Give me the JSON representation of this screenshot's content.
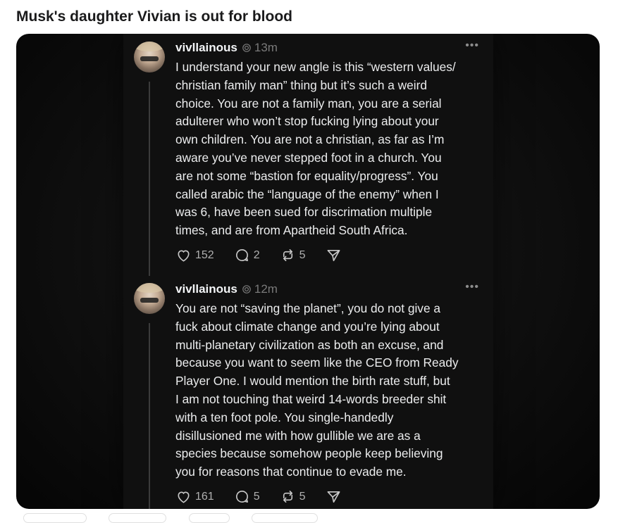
{
  "page": {
    "title": "Musk's daughter Vivian is out for blood"
  },
  "posts": [
    {
      "username": "vivllainous",
      "timestamp": "13m",
      "text": "I understand your new angle is this “western values/\nchristian family man” thing but it’s such a weird\nchoice. You are not a family man, you are a serial\nadulterer who won’t stop fucking lying about your\nown children. You are not a christian, as far as I’m\naware you’ve never stepped foot in a church. You\nare not some “bastion for equality/progress”. You\ncalled arabic the “language of the enemy” when I\nwas 6, have been sued for discrimation multiple\ntimes, and are from Apartheid South Africa.",
      "likes": "152",
      "replies": "2",
      "reposts": "5"
    },
    {
      "username": "vivllainous",
      "timestamp": "12m",
      "text": "You are not “saving the planet”, you do not give a\nfuck about climate change and you’re lying about\nmulti-planetary civilization as both an excuse, and\nbecause you want to seem like the CEO from Ready\nPlayer One. I would mention the birth rate stuff, but\nI am not touching that weird 14-words breeder shit\nwith a ten foot pole. You single-handedly\ndisillusioned me with how gullible we are as a\nspecies because somehow people keep believing\nyou for reasons that continue to evade me.",
      "likes": "161",
      "replies": "5",
      "reposts": "5"
    }
  ],
  "icons": {
    "more": "more-icon",
    "like": "heart-icon",
    "reply": "comment-icon",
    "repost": "repost-icon",
    "share": "send-icon"
  },
  "colors": {
    "background": "#101010",
    "text": "#ecedee",
    "muted": "#7a7a7a"
  }
}
